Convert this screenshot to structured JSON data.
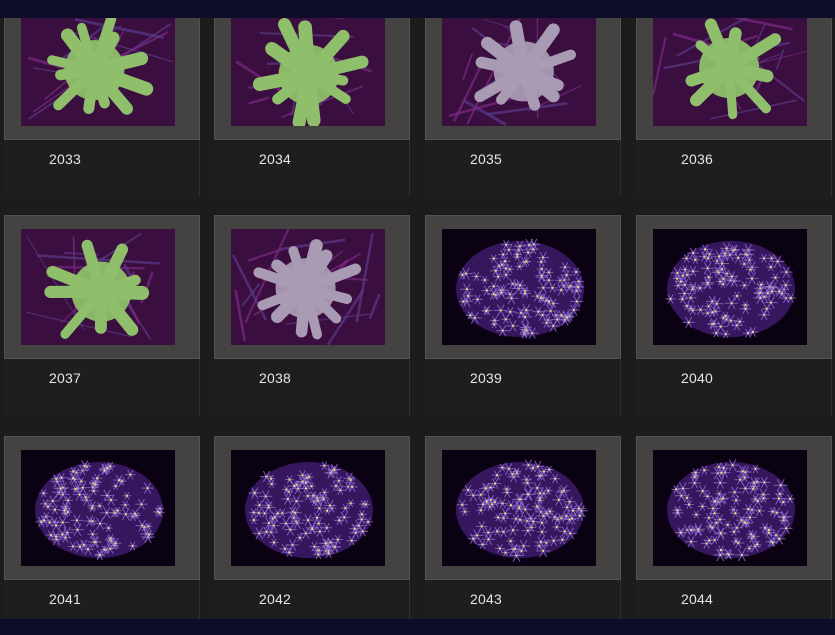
{
  "gallery": {
    "items": [
      {
        "id": "2033",
        "label": "2033",
        "subject": "green-leather-coral"
      },
      {
        "id": "2034",
        "label": "2034",
        "subject": "green-leather-coral"
      },
      {
        "id": "2035",
        "label": "2035",
        "subject": "lavender-leather-coral"
      },
      {
        "id": "2036",
        "label": "2036",
        "subject": "green-leather-coral"
      },
      {
        "id": "2037",
        "label": "2037",
        "subject": "green-leather-coral"
      },
      {
        "id": "2038",
        "label": "2038",
        "subject": "lavender-leather-coral"
      },
      {
        "id": "2039",
        "label": "2039",
        "subject": "purple-polyp-colony"
      },
      {
        "id": "2040",
        "label": "2040",
        "subject": "purple-polyp-colony"
      },
      {
        "id": "2041",
        "label": "2041",
        "subject": "purple-polyp-colony"
      },
      {
        "id": "2042",
        "label": "2042",
        "subject": "purple-polyp-colony"
      },
      {
        "id": "2043",
        "label": "2043",
        "subject": "purple-polyp-colony"
      },
      {
        "id": "2044",
        "label": "2044",
        "subject": "purple-polyp-colony"
      }
    ]
  },
  "colors": {
    "page_background": "#0d0d2a",
    "gallery_background": "#1c1c1c",
    "photo_mat": "#444341",
    "caption_text": "#e6e6e6",
    "coral_green": "#8fbf6a",
    "coral_lavender": "#a99bb3",
    "polyp_violet": "#8a6ad0"
  }
}
